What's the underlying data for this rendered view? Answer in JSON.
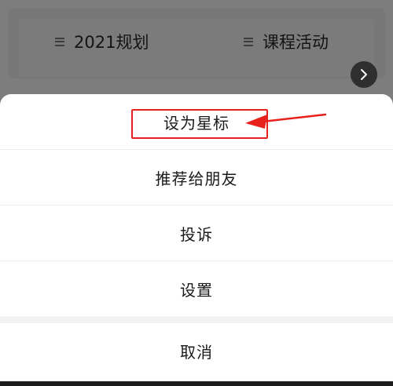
{
  "background_menu": {
    "items": [
      {
        "label": "2021规划",
        "icon": "hamburger-icon"
      },
      {
        "label": "课程活动",
        "icon": "hamburger-icon"
      }
    ],
    "next_icon": "chevron-right-icon"
  },
  "action_sheet": {
    "star_label": "设为星标",
    "recommend_label": "推荐给朋友",
    "complain_label": "投诉",
    "settings_label": "设置",
    "cancel_label": "取消"
  },
  "annotation": {
    "highlight_color": "#e8201c",
    "arrow_color": "#e8201c"
  }
}
